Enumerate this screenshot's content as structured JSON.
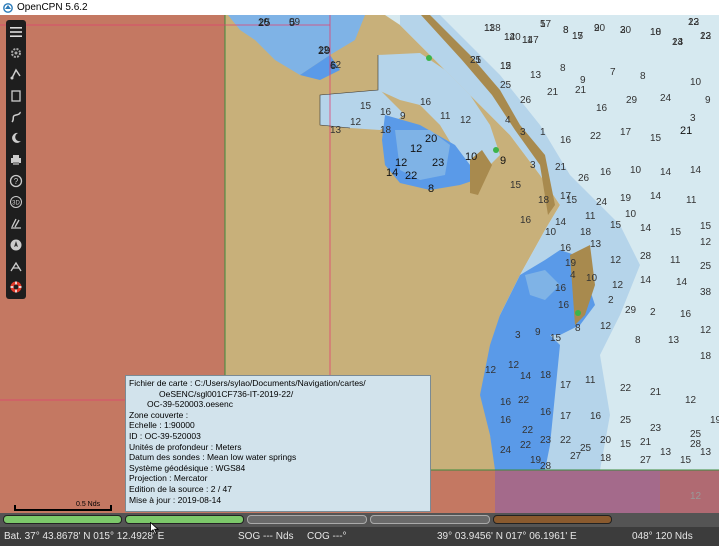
{
  "window": {
    "title": "OpenCPN 5.6.2"
  },
  "toolbar": {
    "items": [
      {
        "name": "menu"
      },
      {
        "name": "settings"
      },
      {
        "name": "route"
      },
      {
        "name": "waypoint"
      },
      {
        "name": "track"
      },
      {
        "name": "moon"
      },
      {
        "name": "print"
      },
      {
        "name": "help"
      },
      {
        "name": "3d"
      },
      {
        "name": "ais"
      },
      {
        "name": "compass"
      },
      {
        "name": "tide"
      },
      {
        "name": "mob"
      }
    ]
  },
  "soundings": [
    "5",
    "25",
    "29",
    "6",
    "138",
    "140",
    "147",
    "5",
    "8",
    "20",
    "17",
    "20",
    "18",
    "24",
    "22",
    "23",
    "21",
    "15",
    "13",
    "8",
    "9",
    "7",
    "8",
    "10",
    "9",
    "25",
    "26",
    "21",
    "21",
    "16",
    "29",
    "24",
    "3",
    "4",
    "3",
    "1",
    "16",
    "22",
    "17",
    "15",
    "21",
    "20",
    "12",
    "23",
    "10",
    "12",
    "14",
    "22",
    "8",
    "9",
    "3",
    "21",
    "26",
    "16",
    "10",
    "14",
    "14",
    "15",
    "18",
    "15",
    "24",
    "19",
    "14",
    "11",
    "16",
    "14",
    "18",
    "15",
    "14",
    "15",
    "15",
    "15",
    "16",
    "9",
    "16",
    "11",
    "12",
    "18",
    "12",
    "13",
    "19",
    "4",
    "10",
    "12",
    "14",
    "14",
    "38",
    "2",
    "29",
    "2",
    "16",
    "12",
    "16",
    "16",
    "3",
    "9",
    "15",
    "8",
    "12",
    "8",
    "13",
    "18",
    "12",
    "12",
    "14",
    "18",
    "17",
    "11",
    "22",
    "21",
    "12",
    "16",
    "22",
    "16",
    "17",
    "16",
    "25",
    "23",
    "25",
    "16",
    "22",
    "23",
    "22",
    "24",
    "19",
    "28",
    "27",
    "18",
    "27",
    "15",
    "20",
    "15",
    "22",
    "25",
    "21",
    "13",
    "13",
    "28",
    "19",
    "10",
    "16",
    "13",
    "12",
    "28",
    "11",
    "25",
    "12",
    "17",
    "11",
    "10",
    "09",
    "10",
    "12",
    "12",
    "11",
    "12",
    "11",
    "17",
    "8",
    "9",
    "15",
    "3",
    "10",
    "13",
    "13",
    "12",
    "25",
    "12"
  ],
  "info_panel": {
    "lines": [
      "Fichier de carte : C:/Users/sylao/Documents/Navigation/cartes/",
      "OeSENC/sgl001CF736-IT-2019-22/",
      "OC-39-520003.oesenc",
      "Zone couverte :",
      "Echelle :   1:90000",
      "ID                    : OC-39-520003",
      "Unités de profondeur   : Meters",
      "Datum des sondes    : Mean low water springs",
      "Système géodésique : WGS84",
      "Projection             : Mercator",
      "Edition de la source  : 2 / 47",
      "Mise à jour            : 2019-08-14"
    ]
  },
  "scale": {
    "label": "0.5 Nds"
  },
  "chart_edge_label": "12",
  "status": {
    "boat": "Bat. 37° 43.8678' N   015° 12.4928' E",
    "sog": "SOG --- Nds",
    "cog": "COG ---°",
    "cursor": "39° 03.9456' N   017° 06.1961' E",
    "bearing_dist": "048°  120 Nds"
  },
  "colors": {
    "land_tan": "#c8b07a",
    "outside_red": "#c47862",
    "deep_water": "#d6e9f0",
    "mid_water": "#b5d4ea",
    "shallow_water": "#7fb3e6",
    "very_shallow": "#5a9ae8",
    "pianobar_green": "#7cc86a",
    "pianobar_brown": "#8a5a2e"
  }
}
